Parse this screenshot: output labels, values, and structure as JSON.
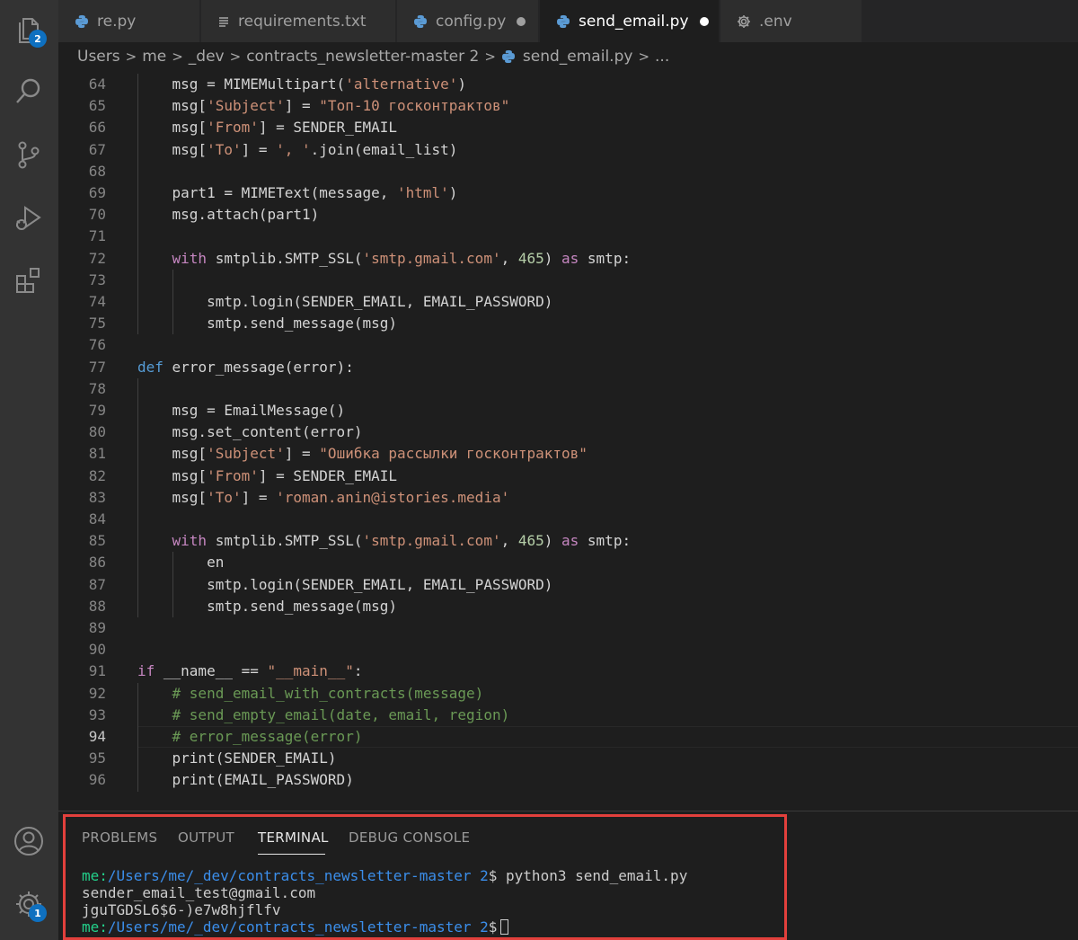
{
  "tabs": [
    {
      "label": "re.py",
      "icon": "python-icon",
      "dirty": false,
      "active": false
    },
    {
      "label": "requirements.txt",
      "icon": "text-file-icon",
      "dirty": false,
      "active": false
    },
    {
      "label": "config.py",
      "icon": "python-icon",
      "dirty": true,
      "active": false
    },
    {
      "label": "send_email.py",
      "icon": "python-icon",
      "dirty": true,
      "active": true
    },
    {
      "label": ".env",
      "icon": "gear-icon",
      "dirty": false,
      "active": false
    }
  ],
  "breadcrumb": {
    "items": [
      "Users",
      "me",
      "_dev",
      "contracts_newsletter-master 2",
      "send_email.py",
      "..."
    ]
  },
  "activity_bar": {
    "explorer_badge": "2",
    "settings_badge": "1"
  },
  "editor": {
    "current_line": 94,
    "lines": [
      {
        "n": "64",
        "indent": 2,
        "tokens": [
          [
            "",
            "msg = MIMEMultipart("
          ],
          [
            "str",
            "'alternative'"
          ],
          [
            "",
            ")"
          ]
        ]
      },
      {
        "n": "65",
        "indent": 2,
        "tokens": [
          [
            "",
            "msg["
          ],
          [
            "str",
            "'Subject'"
          ],
          [
            "",
            "] = "
          ],
          [
            "str",
            "\"Топ-10 госконтрактов\""
          ]
        ]
      },
      {
        "n": "66",
        "indent": 2,
        "tokens": [
          [
            "",
            "msg["
          ],
          [
            "str",
            "'From'"
          ],
          [
            "",
            "] = SENDER_EMAIL"
          ]
        ]
      },
      {
        "n": "67",
        "indent": 2,
        "tokens": [
          [
            "",
            "msg["
          ],
          [
            "str",
            "'To'"
          ],
          [
            "",
            "] = "
          ],
          [
            "str",
            "', '"
          ],
          [
            "",
            ".join(email_list)"
          ]
        ]
      },
      {
        "n": "68",
        "indent": 0,
        "tokens": []
      },
      {
        "n": "69",
        "indent": 2,
        "tokens": [
          [
            "",
            "part1 = MIMEText(message, "
          ],
          [
            "str",
            "'html'"
          ],
          [
            "",
            ")"
          ]
        ]
      },
      {
        "n": "70",
        "indent": 2,
        "tokens": [
          [
            "",
            "msg.attach(part1)"
          ]
        ]
      },
      {
        "n": "71",
        "indent": 0,
        "tokens": []
      },
      {
        "n": "72",
        "indent": 2,
        "tokens": [
          [
            "kw",
            "with"
          ],
          [
            "",
            " smtplib.SMTP_SSL("
          ],
          [
            "str",
            "'smtp.gmail.com'"
          ],
          [
            "",
            ", "
          ],
          [
            "num",
            "465"
          ],
          [
            "",
            ") "
          ],
          [
            "kw",
            "as"
          ],
          [
            "",
            " smtp:"
          ]
        ]
      },
      {
        "n": "73",
        "indent": 0,
        "tokens": []
      },
      {
        "n": "74",
        "indent": 3,
        "tokens": [
          [
            "",
            "smtp.login(SENDER_EMAIL, EMAIL_PASSWORD)"
          ]
        ]
      },
      {
        "n": "75",
        "indent": 3,
        "tokens": [
          [
            "",
            "smtp.send_message(msg)"
          ]
        ]
      },
      {
        "n": "76",
        "indent": 0,
        "tokens": []
      },
      {
        "n": "77",
        "indent": 1,
        "tokens": [
          [
            "kw2",
            "def"
          ],
          [
            "",
            " error_message(error):"
          ]
        ]
      },
      {
        "n": "78",
        "indent": 0,
        "tokens": []
      },
      {
        "n": "79",
        "indent": 2,
        "tokens": [
          [
            "",
            "msg = EmailMessage()"
          ]
        ]
      },
      {
        "n": "80",
        "indent": 2,
        "tokens": [
          [
            "",
            "msg.set_content(error)"
          ]
        ]
      },
      {
        "n": "81",
        "indent": 2,
        "tokens": [
          [
            "",
            "msg["
          ],
          [
            "str",
            "'Subject'"
          ],
          [
            "",
            "] = "
          ],
          [
            "str",
            "\"Ошибка рассылки госконтрактов\""
          ]
        ]
      },
      {
        "n": "82",
        "indent": 2,
        "tokens": [
          [
            "",
            "msg["
          ],
          [
            "str",
            "'From'"
          ],
          [
            "",
            "] = SENDER_EMAIL"
          ]
        ]
      },
      {
        "n": "83",
        "indent": 2,
        "tokens": [
          [
            "",
            "msg["
          ],
          [
            "str",
            "'To'"
          ],
          [
            "",
            "] = "
          ],
          [
            "str",
            "'roman.anin@istories.media'"
          ]
        ]
      },
      {
        "n": "84",
        "indent": 0,
        "tokens": []
      },
      {
        "n": "85",
        "indent": 2,
        "tokens": [
          [
            "kw",
            "with"
          ],
          [
            "",
            " smtplib.SMTP_SSL("
          ],
          [
            "str",
            "'smtp.gmail.com'"
          ],
          [
            "",
            ", "
          ],
          [
            "num",
            "465"
          ],
          [
            "",
            ") "
          ],
          [
            "kw",
            "as"
          ],
          [
            "",
            " smtp:"
          ]
        ]
      },
      {
        "n": "86",
        "indent": 3,
        "tokens": [
          [
            "",
            "en"
          ]
        ]
      },
      {
        "n": "87",
        "indent": 3,
        "tokens": [
          [
            "",
            "smtp.login(SENDER_EMAIL, EMAIL_PASSWORD)"
          ]
        ]
      },
      {
        "n": "88",
        "indent": 3,
        "tokens": [
          [
            "",
            "smtp.send_message(msg)"
          ]
        ]
      },
      {
        "n": "89",
        "indent": 0,
        "tokens": []
      },
      {
        "n": "90",
        "indent": 0,
        "tokens": []
      },
      {
        "n": "91",
        "indent": 1,
        "tokens": [
          [
            "kw",
            "if"
          ],
          [
            "",
            " __name__ == "
          ],
          [
            "str",
            "\"__main__\""
          ],
          [
            "",
            ":"
          ]
        ]
      },
      {
        "n": "92",
        "indent": 2,
        "tokens": [
          [
            "cmt",
            "# send_email_with_contracts(message)"
          ]
        ]
      },
      {
        "n": "93",
        "indent": 2,
        "tokens": [
          [
            "cmt",
            "# send_empty_email(date, email, region)"
          ]
        ]
      },
      {
        "n": "94",
        "indent": 2,
        "tokens": [
          [
            "cmt",
            "# error_message(error)"
          ]
        ]
      },
      {
        "n": "95",
        "indent": 2,
        "tokens": [
          [
            "",
            "print(SENDER_EMAIL)"
          ]
        ]
      },
      {
        "n": "96",
        "indent": 2,
        "tokens": [
          [
            "",
            "print(EMAIL_PASSWORD)"
          ]
        ]
      }
    ]
  },
  "panel": {
    "tabs": [
      "PROBLEMS",
      "OUTPUT",
      "TERMINAL",
      "DEBUG CONSOLE"
    ],
    "active_tab": "TERMINAL",
    "terminal": {
      "prompt_user": "me:",
      "prompt_path": "/Users/me/_dev/contracts_newsletter-master 2",
      "prompt_suffix": "$",
      "command": "python3 send_email.py",
      "output": [
        "sender_email_test@gmail.com",
        "jguTGDSL6$6-)e7w8hjflfv"
      ]
    }
  },
  "colors": {
    "keyword": "#c586c0",
    "def_keyword": "#569cd6",
    "string": "#ce9178",
    "number": "#b5cea8",
    "comment": "#6a9955",
    "highlight_box": "#e2403c"
  }
}
